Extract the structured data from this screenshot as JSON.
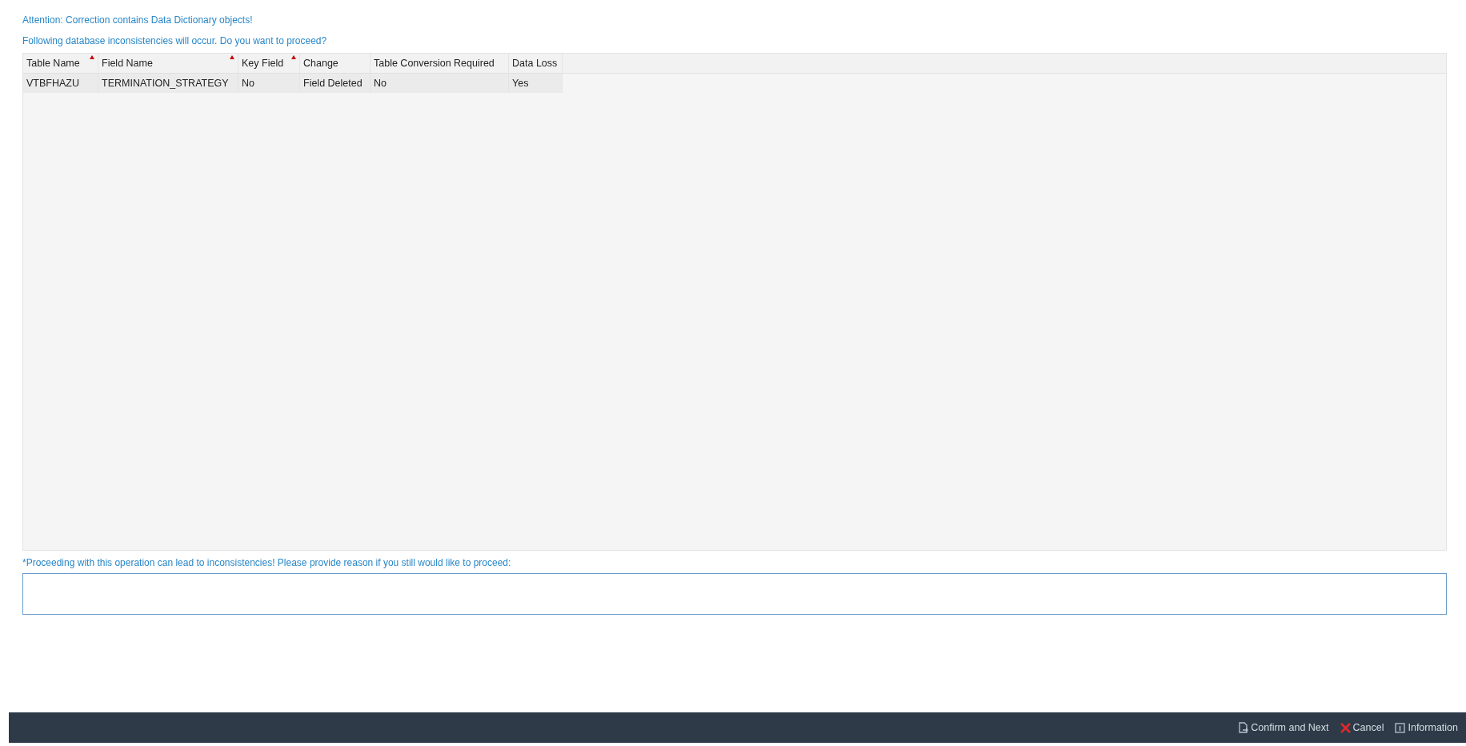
{
  "messages": [
    "Attention: Correction contains Data Dictionary objects!",
    "Following database inconsistencies will occur. Do you want to proceed?"
  ],
  "table": {
    "columns": [
      {
        "label": "Table Name",
        "sorted": true
      },
      {
        "label": "Field Name",
        "sorted": true
      },
      {
        "label": "Key Field",
        "sorted": true
      },
      {
        "label": "Change",
        "sorted": false
      },
      {
        "label": "Table Conversion Required",
        "sorted": false
      },
      {
        "label": "Data Loss",
        "sorted": false
      }
    ],
    "rows": [
      [
        "VTBFHAZU",
        "TERMINATION_STRATEGY",
        "No",
        "Field Deleted",
        "No",
        "Yes"
      ]
    ]
  },
  "reason": {
    "label": "*Proceeding with this operation can lead to inconsistencies! Please provide reason if you still would like to proceed:"
  },
  "footer": {
    "buttons": [
      {
        "label": "Confirm and Next",
        "kind": "confirm"
      },
      {
        "label": "Cancel",
        "kind": "cancel"
      },
      {
        "label": "Information",
        "kind": "info"
      }
    ]
  }
}
